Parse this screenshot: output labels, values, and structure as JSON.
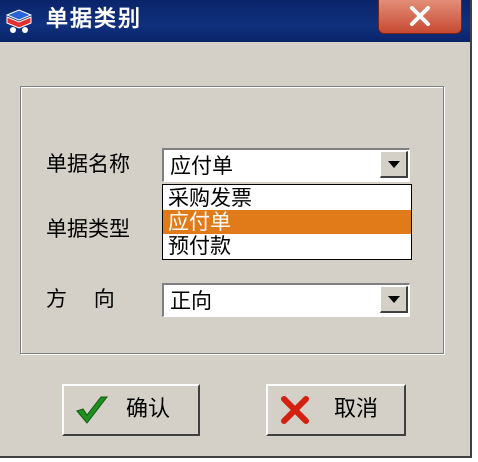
{
  "window": {
    "title": "单据类别",
    "icon": "app-icon"
  },
  "form": {
    "name_label": "单据名称",
    "name_value": "应付单",
    "type_label": "单据类型",
    "direction_label": "方    向",
    "direction_value": "正向"
  },
  "dropdown": {
    "options": [
      "采购发票",
      "应付单",
      "预付款"
    ],
    "selected_index": 1
  },
  "buttons": {
    "ok_label": "确认",
    "cancel_label": "取消"
  },
  "colors": {
    "titlebar": "#0a246a",
    "highlight": "#e17a18",
    "ok_check": "#1f8f1f",
    "cancel_x": "#d42010"
  }
}
